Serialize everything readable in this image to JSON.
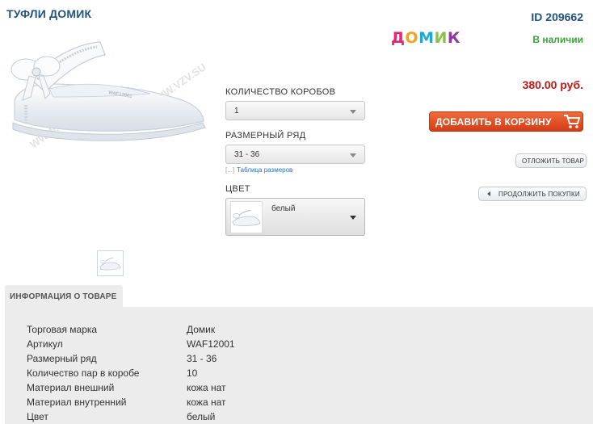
{
  "product": {
    "title": "ТУФЛИ ДОМИК",
    "id_label": "ID 209662",
    "stock": "В наличии",
    "price": "380.00 руб."
  },
  "brand_logo": {
    "letters": [
      "Д",
      "О",
      "М",
      "И",
      "К"
    ],
    "colors": [
      "#e6266e",
      "#f6a01c",
      "#1fa7d8",
      "#8bc34a",
      "#8e3a9d"
    ]
  },
  "image": {
    "watermark": "WWW.VZV.SU",
    "shoe_label": "WAF12001"
  },
  "options": {
    "boxes": {
      "label": "КОЛИЧЕСТВО КОРОБОВ",
      "value": "1"
    },
    "size_range": {
      "label": "РАЗМЕРНЫЙ РЯД",
      "value": "31 - 36",
      "link_bracket": "[...]",
      "link": "Таблица размеров"
    },
    "color": {
      "label": "ЦВЕТ",
      "value": "белый"
    }
  },
  "buttons": {
    "add_to_cart": "ДОБАВИТЬ В КОРЗИНУ",
    "postpone": "ОТЛОЖИТЬ ТОВАР",
    "continue": "ПРОДОЛЖИТЬ ПОКУПКИ"
  },
  "info": {
    "tab": "ИНФОРМАЦИЯ О ТОВАРЕ",
    "rows": [
      {
        "key": "Торговая марка",
        "value": "Домик"
      },
      {
        "key": "Артикул",
        "value": "WAF12001"
      },
      {
        "key": "Размерный ряд",
        "value": "31 - 36"
      },
      {
        "key": "Количество пар в коробе",
        "value": "10"
      },
      {
        "key": "Материал внешний",
        "value": "кожа нат"
      },
      {
        "key": "Материал внутренний",
        "value": "кожа нат"
      },
      {
        "key": "Цвет",
        "value": "белый"
      }
    ]
  },
  "colors": {
    "title": "#23527c",
    "stock": "#3aa33a",
    "price": "#c01818",
    "cart_button": "#e0471c",
    "link": "#2a6ebb"
  }
}
